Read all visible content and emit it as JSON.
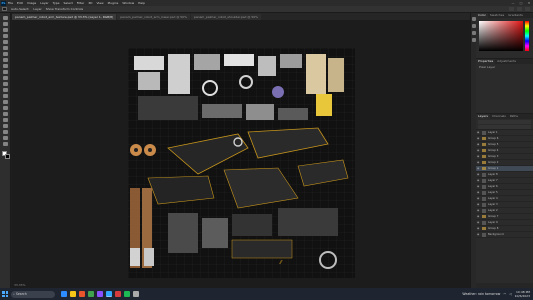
{
  "menubar": {
    "app_logo": "Ps",
    "items": [
      "File",
      "Edit",
      "Image",
      "Layer",
      "Type",
      "Select",
      "Filter",
      "3D",
      "View",
      "Plugins",
      "Window",
      "Help"
    ],
    "window_controls": [
      "—",
      "□",
      "✕"
    ]
  },
  "optionsbar": {
    "options": [
      "Auto-Select:",
      "Layer",
      "Show Transform Controls"
    ],
    "accent": "#31a8ff"
  },
  "tabs": [
    {
      "label": "panam_palmer_robot_arm_texture.psd @ 33.3% (Layer 1, RGB/8)",
      "active": true
    },
    {
      "label": "panam_palmer_robot_arm_lower.psd @ 50%",
      "active": false
    },
    {
      "label": "panam_palmer_robot_shoulder.psd @ 50%",
      "active": false
    }
  ],
  "canvas": {
    "status": "33.33%"
  },
  "panels": {
    "color_tabs": [
      "Color",
      "Swatches",
      "Gradients"
    ],
    "properties_tabs": [
      "Properties",
      "Adjustments"
    ],
    "properties_label": "Pixel Layer",
    "layers_tabs": [
      "Layers",
      "Channels",
      "Paths"
    ],
    "layers": [
      {
        "name": "Layer 1",
        "type": "layer",
        "selected": false
      },
      {
        "name": "Group 6",
        "type": "folder",
        "selected": false
      },
      {
        "name": "Group 5",
        "type": "folder",
        "selected": false
      },
      {
        "name": "Group 4",
        "type": "folder",
        "selected": false
      },
      {
        "name": "Group 3",
        "type": "folder",
        "selected": false
      },
      {
        "name": "Group 2",
        "type": "folder",
        "selected": false
      },
      {
        "name": "Group 1",
        "type": "folder",
        "selected": true
      },
      {
        "name": "Layer 8",
        "type": "layer",
        "selected": false
      },
      {
        "name": "Layer 7",
        "type": "layer",
        "selected": false
      },
      {
        "name": "Layer 6",
        "type": "layer",
        "selected": false
      },
      {
        "name": "Layer 5",
        "type": "layer",
        "selected": false
      },
      {
        "name": "Layer 4",
        "type": "layer",
        "selected": false
      },
      {
        "name": "Layer 3",
        "type": "layer",
        "selected": false
      },
      {
        "name": "Layer 2",
        "type": "layer",
        "selected": false
      },
      {
        "name": "Group 7",
        "type": "folder",
        "selected": false
      },
      {
        "name": "Layer 9",
        "type": "layer",
        "selected": false
      },
      {
        "name": "Group 8",
        "type": "folder",
        "selected": false
      },
      {
        "name": "Background",
        "type": "layer",
        "selected": false
      }
    ],
    "fg_color": "#ffffff",
    "bg_color": "#000000",
    "picker_hue": "#e01414"
  },
  "taskbar": {
    "search_placeholder": "Search",
    "weather": "Weather: rain tomorrow",
    "time": "10:48 PM",
    "date": "10/6/2023",
    "app_colors": [
      "#2d8cff",
      "#f5c518",
      "#e8552c",
      "#3fa34d",
      "#8a4fff",
      "#31a8ff",
      "#d83b3b",
      "#1db954",
      "#aaaaaa"
    ]
  }
}
